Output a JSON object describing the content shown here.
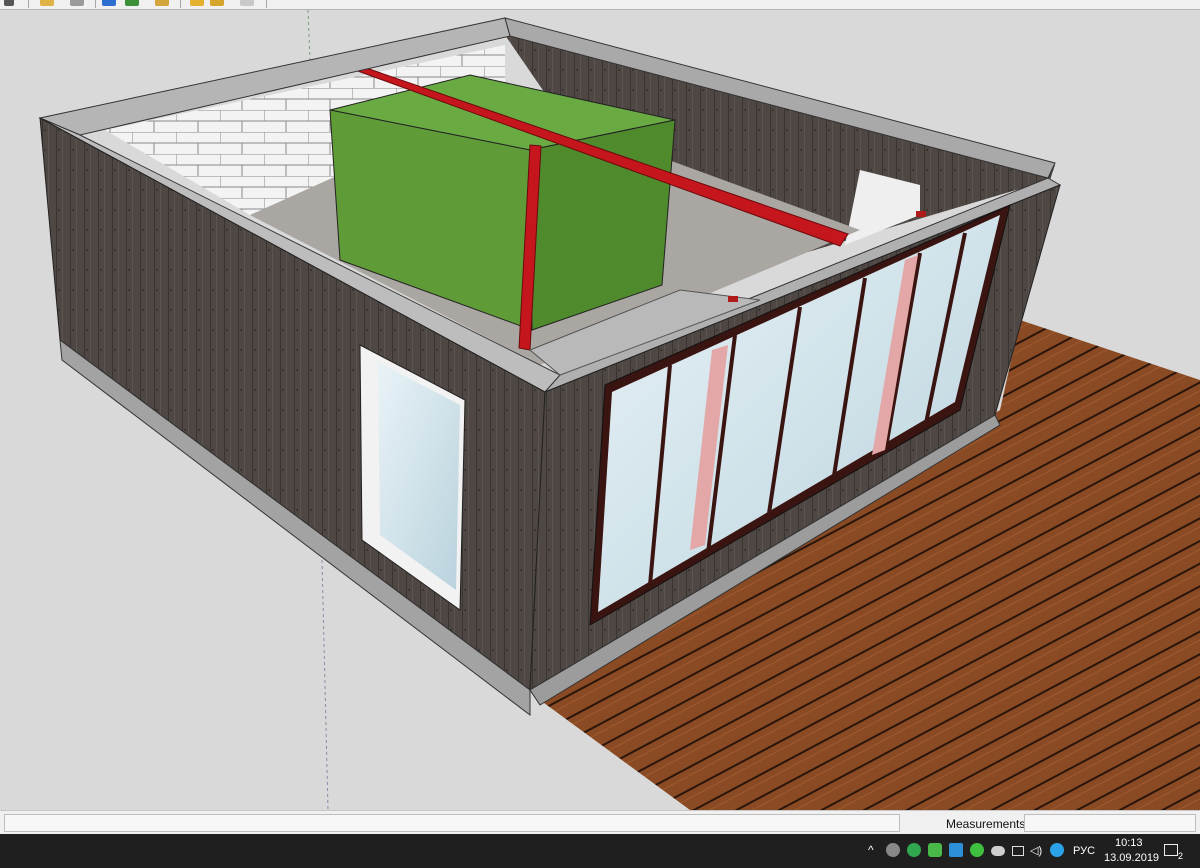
{
  "app": {
    "statusbar": {
      "measurements_label": "Measurements",
      "measurements_value": ""
    }
  },
  "colors": {
    "viewport_bg": "#d9d9d9",
    "wall_wood": "#4b4440",
    "wall_top": "#b3b3b3",
    "brick_wall": "#f2f2f2",
    "green_volume": "#5a9a34",
    "red_beam": "#c4161c",
    "deck_wood": "#8b4b26",
    "glass": "#cfe3ea",
    "taskbar": "#1f1f1f"
  },
  "taskbar": {
    "tray_icons": [
      "chevron-up-icon",
      "skype-icon",
      "green-dot-icon",
      "shield-icon",
      "app-icon",
      "clover-icon",
      "cloud-icon",
      "network-icon",
      "volume-icon",
      "messenger-icon"
    ],
    "language": "РУС",
    "time": "10:13",
    "date": "13.09.2019",
    "notification_count": "2"
  }
}
